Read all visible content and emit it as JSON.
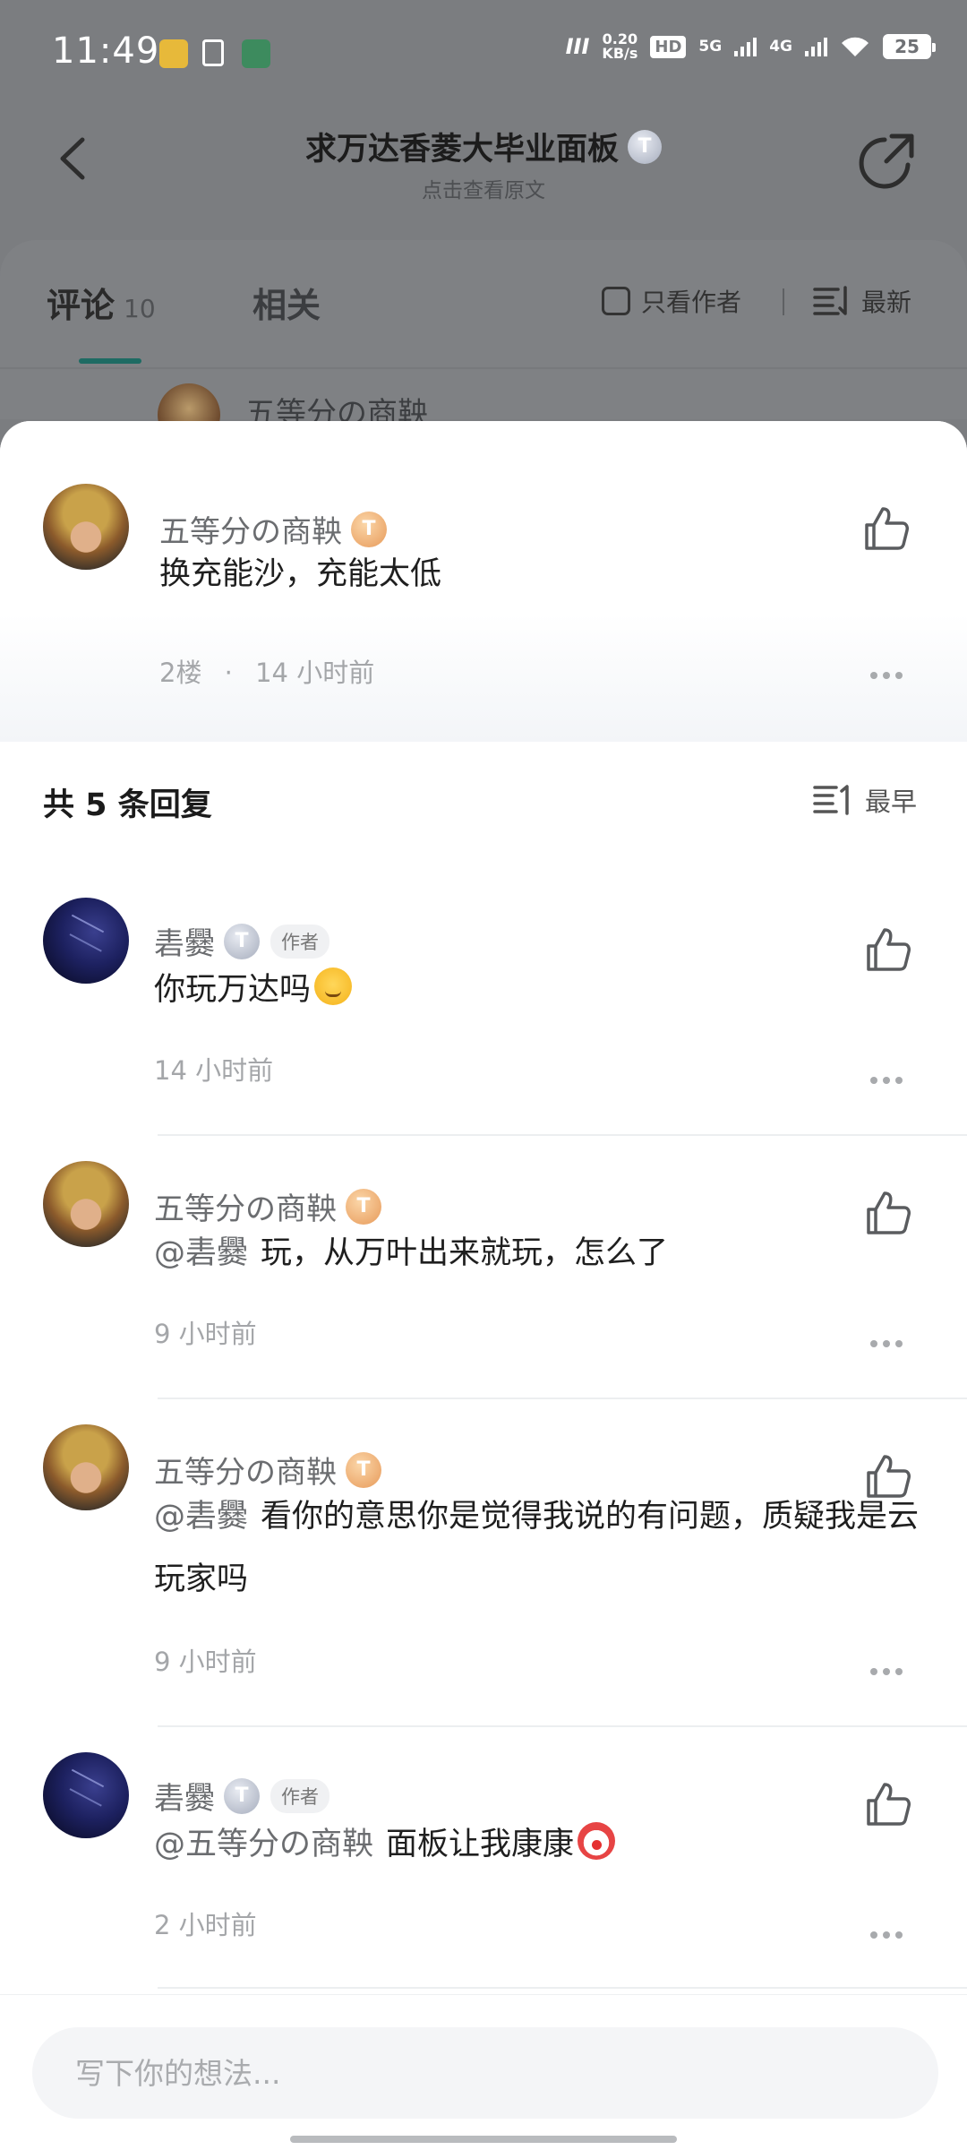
{
  "status_bar": {
    "time": "11:49",
    "net_speed_value": "0.20",
    "net_speed_unit": "KB/s",
    "hd_label": "HD",
    "sig1_label": "5G",
    "sig2_label": "4G",
    "battery": "25"
  },
  "header": {
    "title": "求万达香菱大毕业面板",
    "subtitle": "点击查看原文",
    "title_badge": "T"
  },
  "tabs": {
    "comments_label": "评论",
    "comments_count": "10",
    "related_label": "相关",
    "author_only_label": "只看作者",
    "sort_label": "最新"
  },
  "peek": {
    "name": "五等分の商鞅"
  },
  "main_comment": {
    "name": "五等分の商鞅",
    "badge": "T",
    "content": "换充能沙，充能太低",
    "floor": "2楼",
    "separator": "·",
    "time": "14 小时前"
  },
  "replies_header": {
    "title": "共 5 条回复",
    "sort_label": "最早"
  },
  "replies": [
    {
      "name": "砉爨",
      "badge": "T",
      "author_tag": "作者",
      "mention": "",
      "content": "你玩万达吗",
      "emoji": "smirk",
      "time": "14 小时前"
    },
    {
      "name": "五等分の商鞅",
      "badge": "T",
      "author_tag": "",
      "mention": "@砉爨",
      "content": "玩，从万叶出来就玩，怎么了",
      "emoji": "",
      "time": "9 小时前"
    },
    {
      "name": "五等分の商鞅",
      "badge": "T",
      "author_tag": "",
      "mention": "@砉爨",
      "content": "看你的意思你是觉得我说的有问题，质疑我是云玩家吗",
      "emoji": "",
      "time": "9 小时前"
    },
    {
      "name": "砉爨",
      "badge": "T",
      "author_tag": "作者",
      "mention": "@五等分の商鞅",
      "content": "面板让我康康",
      "emoji": "clown",
      "time": "2 小时前"
    }
  ],
  "input": {
    "placeholder": "写下你的想法..."
  },
  "colors": {
    "accent": "#1e6b63",
    "overlay": "#7b7d80",
    "meta_text": "#a4a6a9"
  }
}
